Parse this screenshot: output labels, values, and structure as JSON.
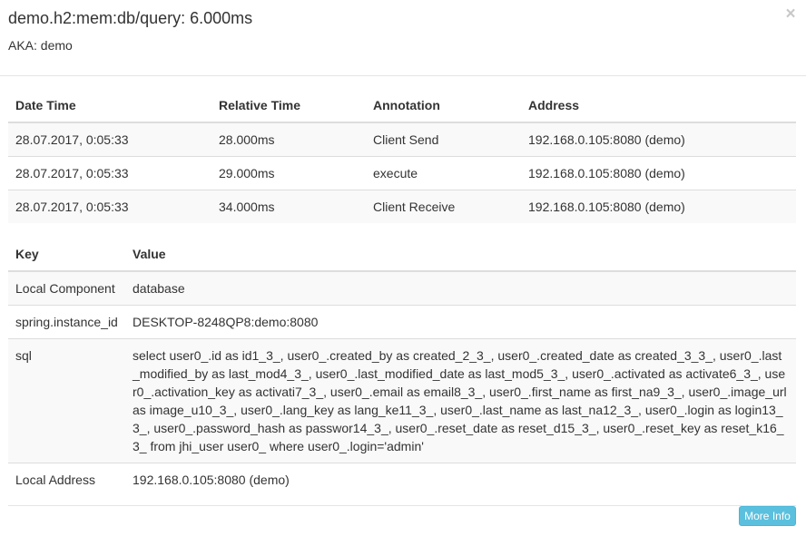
{
  "modal": {
    "title": "demo.h2:mem:db/query: 6.000ms",
    "aka": "AKA: demo",
    "close_glyph": "×"
  },
  "annotations": {
    "columns": [
      "Date Time",
      "Relative Time",
      "Annotation",
      "Address"
    ],
    "rows": [
      [
        "28.07.2017, 0:05:33",
        "28.000ms",
        "Client Send",
        "192.168.0.105:8080 (demo)"
      ],
      [
        "28.07.2017, 0:05:33",
        "29.000ms",
        "execute",
        "192.168.0.105:8080 (demo)"
      ],
      [
        "28.07.2017, 0:05:33",
        "34.000ms",
        "Client Receive",
        "192.168.0.105:8080 (demo)"
      ]
    ]
  },
  "tags": {
    "columns": [
      "Key",
      "Value"
    ],
    "rows": [
      [
        "Local Component",
        "database"
      ],
      [
        "spring.instance_id",
        "DESKTOP-8248QP8:demo:8080"
      ],
      [
        "sql",
        "select user0_.id as id1_3_, user0_.created_by as created_2_3_, user0_.created_date as created_3_3_, user0_.last_modified_by as last_mod4_3_, user0_.last_modified_date as last_mod5_3_, user0_.activated as activate6_3_, user0_.activation_key as activati7_3_, user0_.email as email8_3_, user0_.first_name as first_na9_3_, user0_.image_url as image_u10_3_, user0_.lang_key as lang_ke11_3_, user0_.last_name as last_na12_3_, user0_.login as login13_3_, user0_.password_hash as passwor14_3_, user0_.reset_date as reset_d15_3_, user0_.reset_key as reset_k16_3_ from jhi_user user0_ where user0_.login='admin'"
      ],
      [
        "Local Address",
        "192.168.0.105:8080 (demo)"
      ]
    ]
  },
  "footer": {
    "more_info_label": "More Info"
  },
  "colors": {
    "button": "#5bc0de",
    "stripe": "#f9f9f9",
    "border": "#dddddd"
  }
}
